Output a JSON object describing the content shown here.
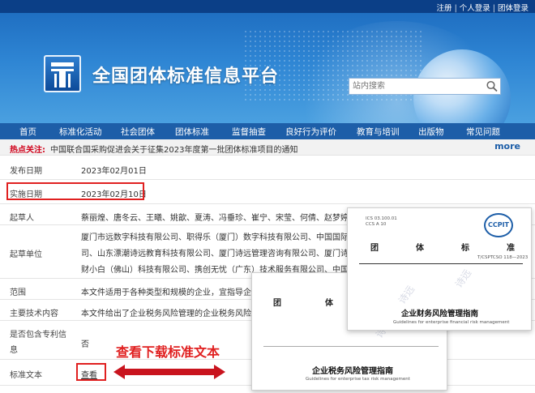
{
  "top_links": [
    "注册",
    "个人登录",
    "团体登录"
  ],
  "site_title": "全国团体标准信息平台",
  "search": {
    "placeholder": "站内搜索"
  },
  "nav": [
    "首页",
    "标准化活动",
    "社会团体",
    "团体标准",
    "监督抽查",
    "良好行为评价",
    "教育与培训",
    "出版物",
    "常见问题"
  ],
  "hot": {
    "label": "热点关注:",
    "text": "中国联合国采购促进会关于征集2023年度第一批团体标准项目的通知",
    "more": "more"
  },
  "details": [
    {
      "key": "发布日期",
      "value": "2023年02月01日"
    },
    {
      "key": "实施日期",
      "value": "2023年02月10日"
    },
    {
      "key": "起草人",
      "value": "蔡丽煌、唐冬云、王曦、姚歆、夏涛、冯垂珍、崔宁、宋莹、何倩、赵梦婷、李"
    },
    {
      "key": "起草单位",
      "lines": [
        "厦门市远数字科技有限公司、职得乐（厦门）数字科技有限公司、中国国际贸易",
        "司、山东漂潮诗远教育科技有限公司、厦门诗远管理咨询有限公司、厦门诗远人才",
        "财小白（佛山）科技有限公司、携创无忧（广东）技术服务有限公司、中国标准化"
      ]
    },
    {
      "key": "范围",
      "value": "本文件适用于各种类型和规模的企业，宜指导企业在"
    },
    {
      "key": "主要技术内容",
      "value": "本文件给出了企业税务风险管理的企业税务风险管理"
    },
    {
      "key": "是否包含专利信息",
      "value": "否"
    },
    {
      "key": "标准文本",
      "value": "查看"
    }
  ],
  "callout": "查看下载标准文本",
  "doc_front": {
    "header": [
      "团",
      "体",
      "标",
      "准"
    ],
    "code": "T/CSPTCSO 118—2023",
    "title": "企业财务风险管理指南",
    "subtitle": "Guidelines for enterprise financial risk management",
    "logo_text": "CCPIT",
    "ics": "ICS 03.100.01",
    "ccs": "CCS A 10"
  },
  "doc_back": {
    "header": [
      "团",
      "体"
    ],
    "title": "企业税务风险管理指南",
    "subtitle": "Guidelines for enterprise tax risk management"
  },
  "colors": {
    "brand_blue": "#1d5ea8",
    "highlight_red": "#e02020",
    "hot_red": "#d0021b"
  }
}
